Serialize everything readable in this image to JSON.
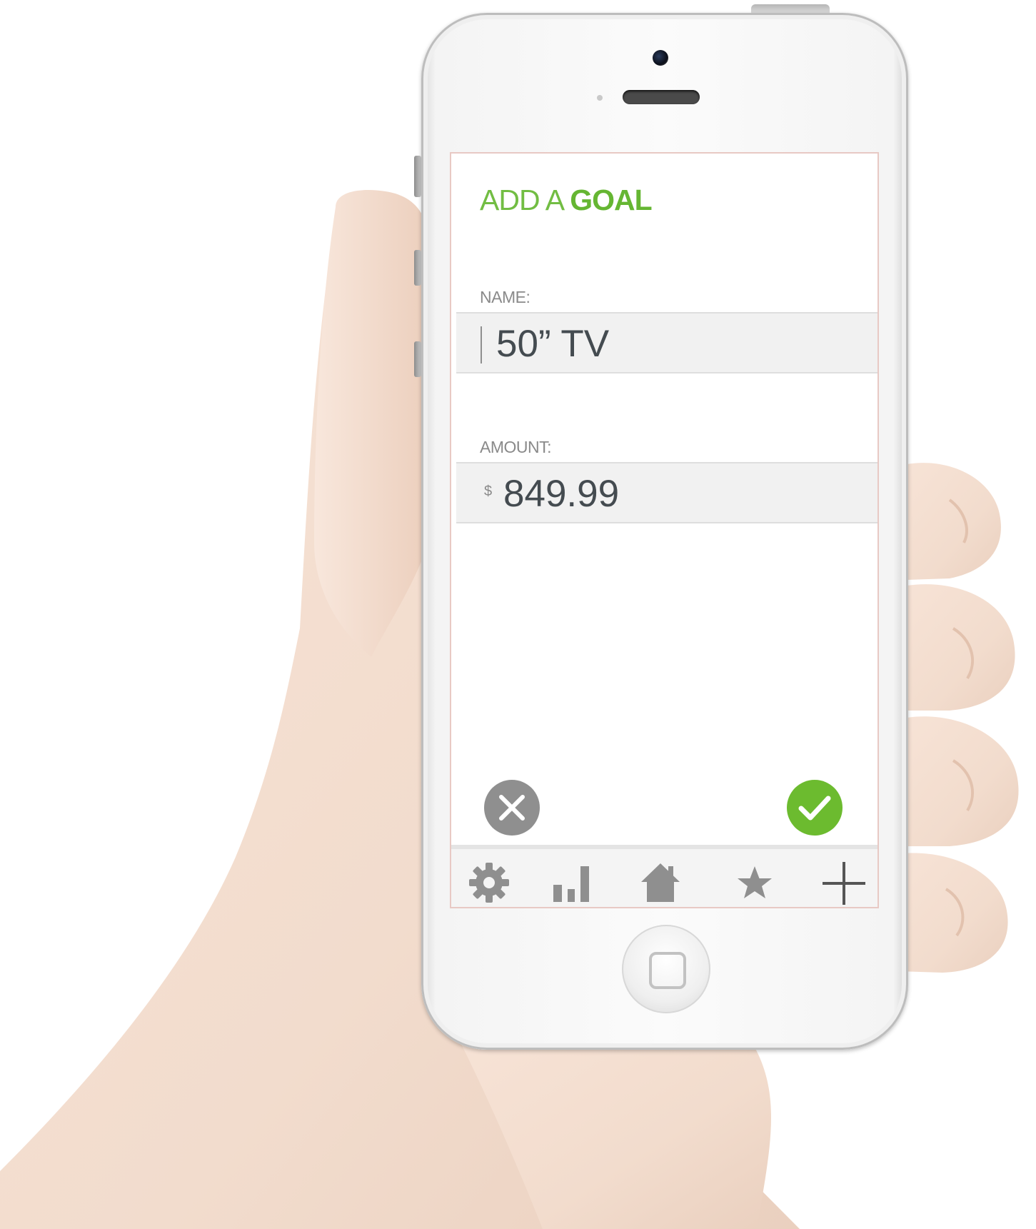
{
  "screen": {
    "title_prefix": "ADD A",
    "title_emphasis": "GOAL",
    "name_field": {
      "label": "NAME:",
      "value": "50” TV"
    },
    "amount_field": {
      "label": "AMOUNT:",
      "currency": "$",
      "value": "849.99"
    },
    "actions": {
      "cancel_icon": "close-circle-icon",
      "confirm_icon": "check-circle-icon"
    },
    "tabbar": {
      "items": [
        {
          "icon": "gear-icon"
        },
        {
          "icon": "bar-chart-icon"
        },
        {
          "icon": "home-icon"
        },
        {
          "icon": "star-icon"
        },
        {
          "icon": "plus-icon"
        }
      ]
    }
  },
  "colors": {
    "accent_green": "#72bd43",
    "cancel_gray": "#8f8f8f",
    "field_bg": "#f1f1f1",
    "value_text": "#444b50",
    "tab_icon": "#8f8f8f"
  }
}
